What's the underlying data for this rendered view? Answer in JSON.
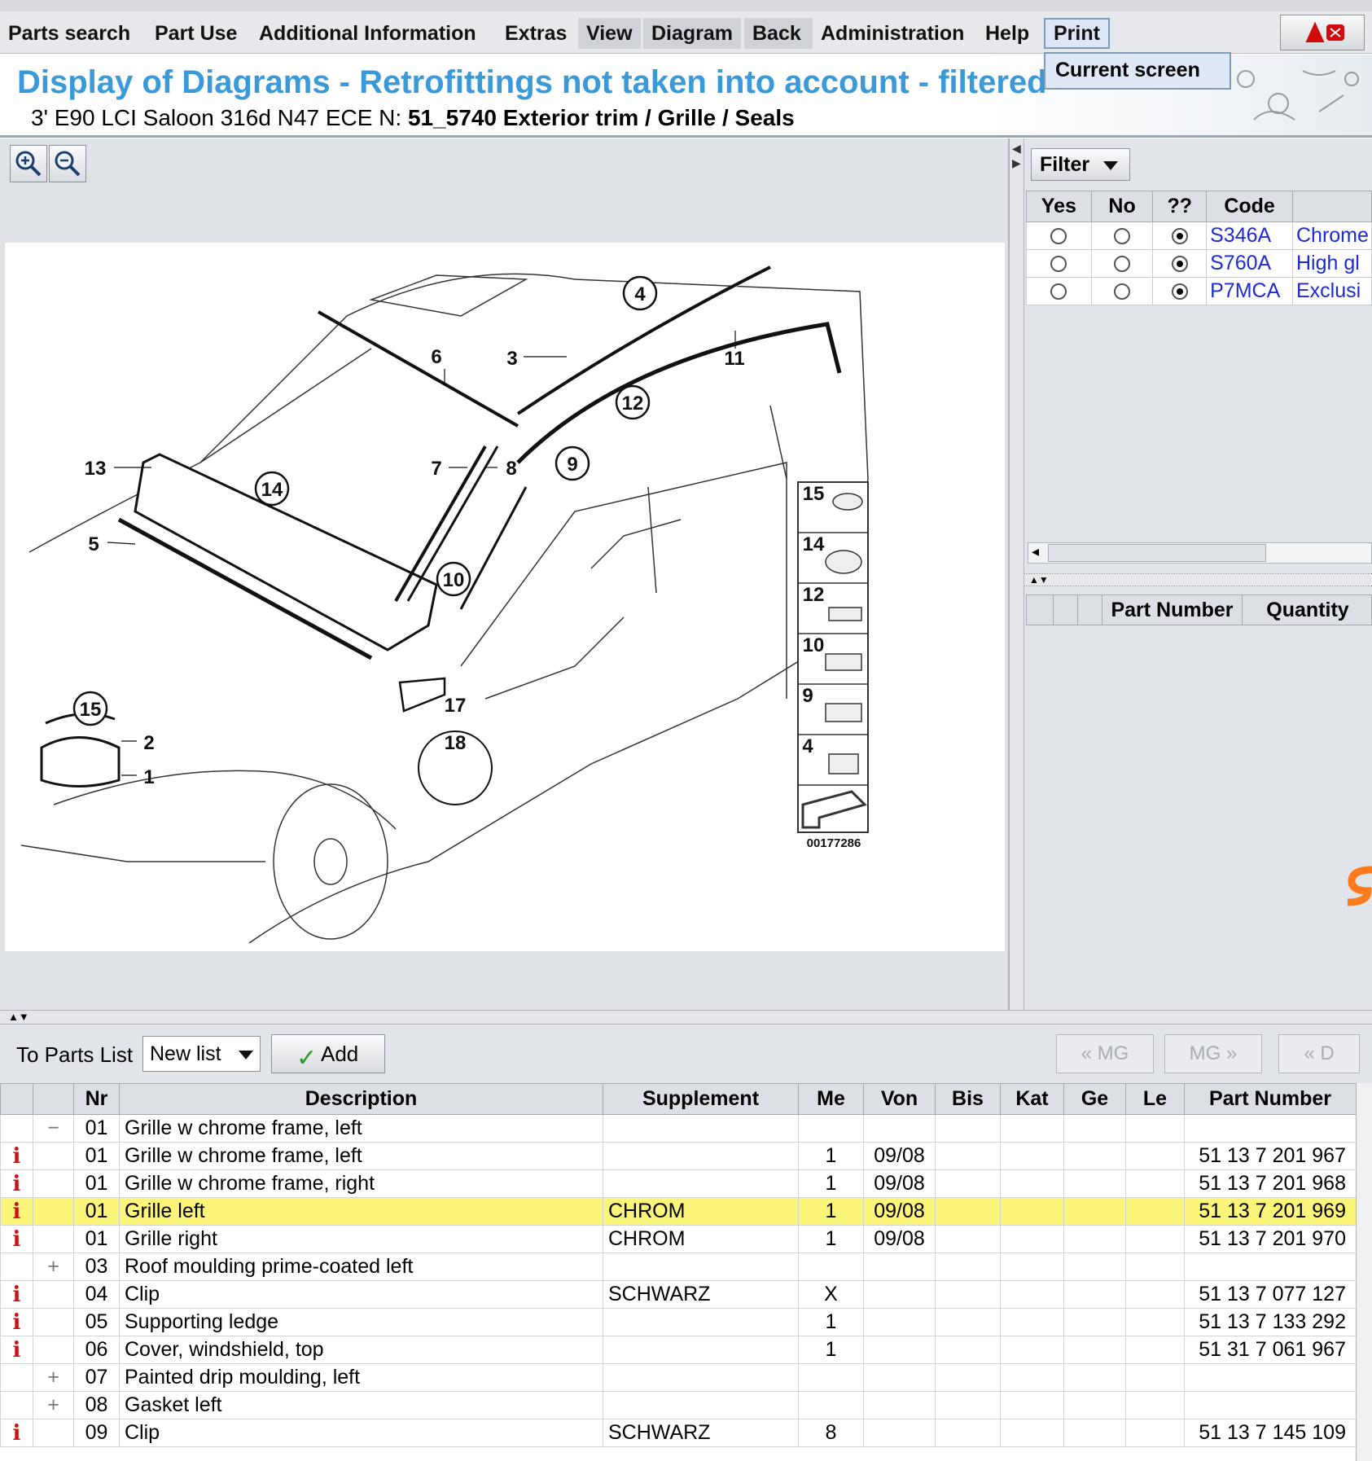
{
  "menu": {
    "items": [
      "Parts search",
      "Part Use",
      "Additional Information",
      "Extras",
      "View",
      "Diagram",
      "Back",
      "Administration",
      "Help",
      "Print"
    ],
    "print_dropdown": [
      "Current screen"
    ]
  },
  "header": {
    "title": "Display of Diagrams - Retrofittings not taken into account - filtered",
    "vehicle": "3' E90 LCI Saloon 316d N47 ECE  N:",
    "group": "51_5740 Exterior trim / Grille / Seals"
  },
  "diagram": {
    "callouts": [
      "1",
      "2",
      "3",
      "4",
      "5",
      "6",
      "7",
      "8",
      "9",
      "10",
      "11",
      "12",
      "13",
      "14",
      "15",
      "17",
      "18"
    ],
    "thumbnails": [
      "15",
      "14",
      "12",
      "10",
      "9",
      "4"
    ],
    "image_number": "00177286"
  },
  "filter": {
    "button_label": "Filter",
    "columns": [
      "Yes",
      "No",
      "??",
      "Code"
    ],
    "rows": [
      {
        "code": "S346A",
        "desc": "Chrome",
        "selected": "??"
      },
      {
        "code": "S760A",
        "desc": "High gl",
        "selected": "??"
      },
      {
        "code": "P7MCA",
        "desc": "Exclusi",
        "selected": "??"
      }
    ]
  },
  "parts_panel": {
    "columns": [
      "Part Number",
      "Quantity"
    ]
  },
  "toolbar": {
    "to_parts_list": "To Parts List",
    "list_value": "New list",
    "add_label": "Add",
    "prev_mg": "« MG",
    "next_mg": "MG »",
    "prev_d": "« D"
  },
  "table": {
    "columns": [
      "Nr",
      "Description",
      "Supplement",
      "Me",
      "Von",
      "Bis",
      "Kat",
      "Ge",
      "Le",
      "Part Number"
    ],
    "rows": [
      {
        "icon": "",
        "exp": "−",
        "nr": "01",
        "desc": "Grille w chrome frame, left",
        "supp": "",
        "me": "",
        "von": "",
        "pn": ""
      },
      {
        "icon": "i",
        "exp": "",
        "nr": "01",
        "desc": "Grille w chrome frame, left",
        "supp": "",
        "me": "1",
        "von": "09/08",
        "pn": "51 13 7 201 967"
      },
      {
        "icon": "i",
        "exp": "",
        "nr": "01",
        "desc": "Grille w chrome frame, right",
        "supp": "",
        "me": "1",
        "von": "09/08",
        "pn": "51 13 7 201 968"
      },
      {
        "icon": "i",
        "exp": "",
        "nr": "01",
        "desc": "Grille left",
        "supp": "CHROM",
        "me": "1",
        "von": "09/08",
        "pn": "51 13 7 201 969",
        "selected": true
      },
      {
        "icon": "i",
        "exp": "",
        "nr": "01",
        "desc": "Grille right",
        "supp": "CHROM",
        "me": "1",
        "von": "09/08",
        "pn": "51 13 7 201 970"
      },
      {
        "icon": "",
        "exp": "+",
        "nr": "03",
        "desc": "Roof moulding prime-coated left",
        "supp": "",
        "me": "",
        "von": "",
        "pn": ""
      },
      {
        "icon": "i",
        "exp": "",
        "nr": "04",
        "desc": "Clip",
        "supp": "SCHWARZ",
        "me": "X",
        "von": "",
        "pn": "51 13 7 077 127"
      },
      {
        "icon": "i",
        "exp": "",
        "nr": "05",
        "desc": "Supporting ledge",
        "supp": "",
        "me": "1",
        "von": "",
        "pn": "51 13 7 133 292"
      },
      {
        "icon": "i",
        "exp": "",
        "nr": "06",
        "desc": "Cover, windshield, top",
        "supp": "",
        "me": "1",
        "von": "",
        "pn": "51 31 7 061 967"
      },
      {
        "icon": "",
        "exp": "+",
        "nr": "07",
        "desc": "Painted drip moulding, left",
        "supp": "",
        "me": "",
        "von": "",
        "pn": ""
      },
      {
        "icon": "",
        "exp": "+",
        "nr": "08",
        "desc": "Gasket left",
        "supp": "",
        "me": "",
        "von": "",
        "pn": ""
      },
      {
        "icon": "i",
        "exp": "",
        "nr": "09",
        "desc": "Clip",
        "supp": "SCHWARZ",
        "me": "8",
        "von": "",
        "pn": "51 13 7 145 109"
      }
    ]
  },
  "colors": {
    "title_blue": "#3a9ad9",
    "link_blue": "#1d2bd3",
    "selected_row": "#fbf57a",
    "info_red": "#c41616"
  }
}
